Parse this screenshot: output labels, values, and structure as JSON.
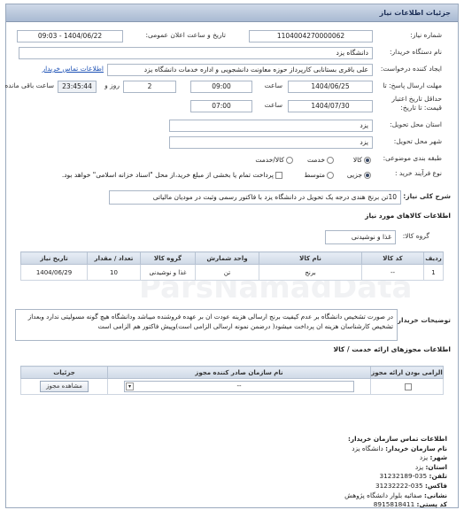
{
  "header": {
    "title": "جزئیات اطلاعات نیاز"
  },
  "watermark": {
    "text": "ParsNamadData",
    "phone": "۰۲۱-۸۸۳۴۹۶۷۰-۵"
  },
  "form": {
    "need_number_label": "شماره نیاز:",
    "need_number": "1104004270000062",
    "announce_label": "تاریخ و ساعت اعلان عمومی:",
    "announce_value": "1404/06/22 - 09:03",
    "buyer_label": "نام دستگاه خریدار:",
    "buyer_value": "دانشگاه یزد",
    "creator_label": "ایجاد کننده درخواست:",
    "creator_value": "علی باقری بستانابی کارپرداز حوزه معاونت دانشجویی و اداره خدمات دانشگاه یزد",
    "buyer_contact_link": "اطلاعات تماس خریدار",
    "deadline_label": "مهلت ارسال پاسخ: تا",
    "deadline_date": "1404/06/25",
    "time_label": "ساعت",
    "deadline_time": "09:00",
    "days_value": "2",
    "days_label": "روز و",
    "remaining_time": "23:45:44",
    "remaining_label": "ساعت باقی مانده",
    "validity_label_1": "حداقل تاریخ اعتبار",
    "validity_label_2": "قیمت: تا تاریخ:",
    "validity_date": "1404/07/30",
    "validity_time": "07:00",
    "province_label": "استان محل تحویل:",
    "province_value": "یزد",
    "city_label": "شهر محل تحویل:",
    "city_value": "یزد",
    "category_label": "طبقه بندی موضوعی:",
    "category_options": [
      "کالا",
      "خدمت",
      "کالا/خدمت"
    ],
    "process_label": "نوع فرآیند خرید :",
    "process_options": [
      "جزیی",
      "متوسط"
    ],
    "payment_note": "پرداخت تمام یا بخشی از مبلغ خرید،از محل \"اسناد خزانه اسلامی\" خواهد بود."
  },
  "summary": {
    "label": "شرح کلی نیاز:",
    "text": "10تن برنج هندی درجه یک تحویل در دانشگاه یزد با فاکتور رسمی وثبت در مودیان مالیاتی"
  },
  "goods": {
    "section_title": "اطلاعات کالاهای مورد نیاز",
    "group_label": "گروه کالا:",
    "group_value": "غذا و نوشیدنی",
    "columns": [
      "ردیف",
      "کد کالا",
      "نام کالا",
      "واحد شمارش",
      "گروه کالا",
      "تعداد / مقدار",
      "تاریخ نیاز"
    ],
    "rows": [
      [
        "1",
        "--",
        "برنج",
        "تن",
        "غذا و نوشیدنی",
        "10",
        "1404/06/29"
      ]
    ],
    "buyer_desc_label": "توضیحات خریدار:",
    "buyer_desc": "در صورت تشخیص دانشگاه بر عدم کیفیت برنج ارسالی هزینه عودت ان بر عهده فروشنده میباشد ودانشگاه هیچ گونه مسولیتی ندارد وبعداز تشخیص کارشناسان هزینه ان پرداخت میشود( درضمن نمونه ارسالی الزامی است)وپیش فاکتور هم الزامی است"
  },
  "licenses": {
    "section_title": "اطلاعات مجوزهای ارائه خدمت / کالا",
    "columns": [
      "الزامی بودن ارائه مجوز",
      "نام سازمان صادر کننده مجوز",
      "جزئیات"
    ],
    "org_value": "--",
    "view_button": "مشاهده مجوز"
  },
  "contact": {
    "heading": "اطلاعات تماس سازمان خریدار:",
    "lines": [
      {
        "label": "نام سازمان خریدار:",
        "value": "دانشگاه یزد"
      },
      {
        "label": "شهر:",
        "value": "یزد"
      },
      {
        "label": "استان:",
        "value": "یزد"
      },
      {
        "label": "تلفن:",
        "value": "035-31232189"
      },
      {
        "label": "فاکس:",
        "value": "035-31232222"
      },
      {
        "label": "نشانی:",
        "value": "صفائیه بلوار دانشگاه پژوهش"
      },
      {
        "label": "کد پستی:",
        "value": "8915818411"
      }
    ]
  },
  "colors": {
    "accent": "#1a4fb4",
    "title_bg": "#b9c7db",
    "border": "#aab6c6"
  }
}
